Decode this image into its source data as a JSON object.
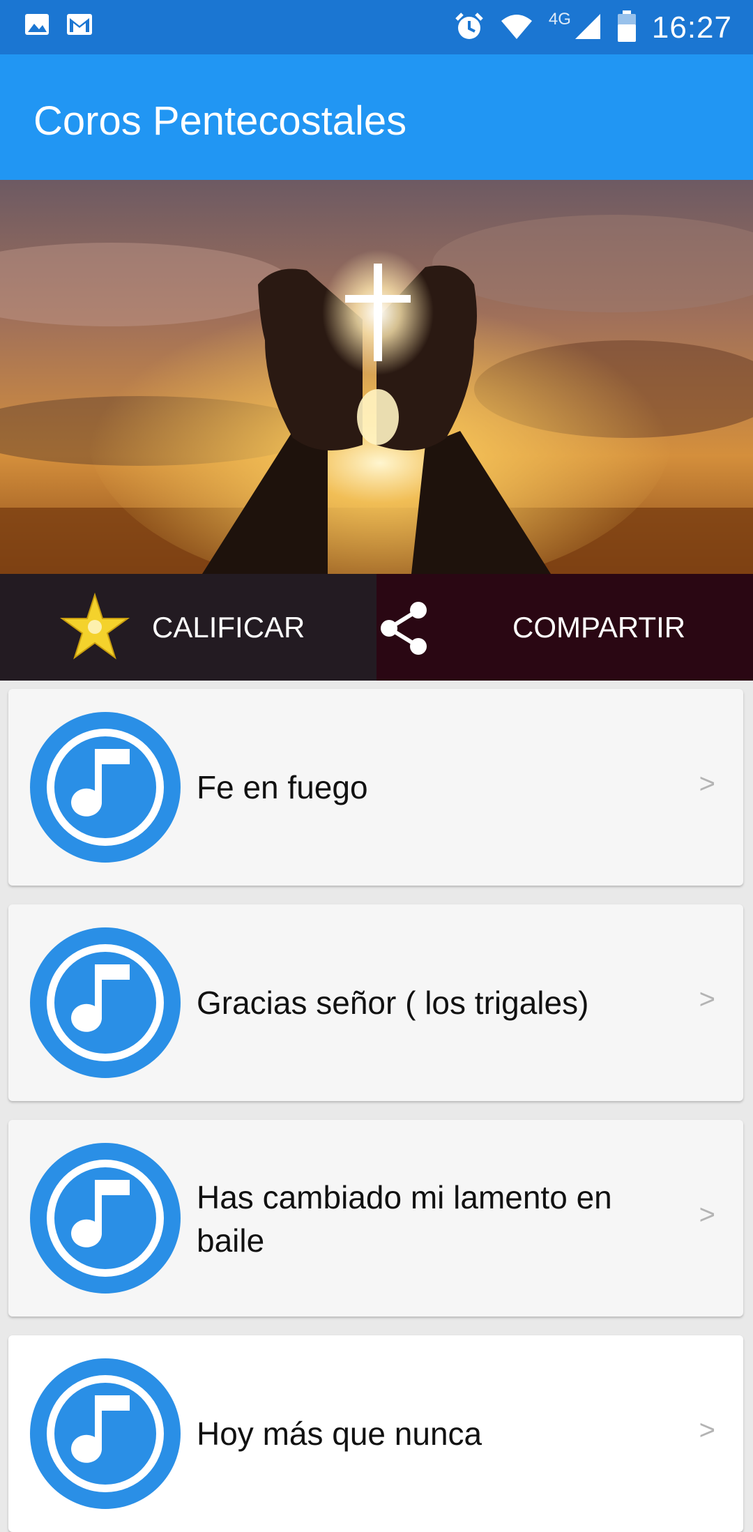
{
  "status_bar": {
    "time": "16:27",
    "network": "4G",
    "icons": [
      "image-icon",
      "gmail-icon",
      "alarm-icon",
      "wifi-icon",
      "signal-icon",
      "battery-icon"
    ]
  },
  "app_bar": {
    "title": "Coros Pentecostales",
    "color": "#2196f3"
  },
  "hero": {
    "image_description_icon": "praying-hands-cross-image"
  },
  "actions": {
    "rate": {
      "label": "CALIFICAR",
      "icon": "star-icon"
    },
    "share": {
      "label": "COMPARTIR",
      "icon": "share-icon"
    }
  },
  "songs": [
    {
      "title": "Fe en fuego",
      "chevron": ">",
      "icon": "music-note-icon"
    },
    {
      "title": "Gracias señor ( los trigales)",
      "chevron": ">",
      "icon": "music-note-icon"
    },
    {
      "title": "Has cambiado mi lamento en baile",
      "chevron": ">",
      "icon": "music-note-icon"
    },
    {
      "title": "Hoy más que nunca",
      "chevron": ">",
      "icon": "music-note-icon"
    }
  ],
  "colors": {
    "accent": "#2196f3",
    "status": "#1b76d2",
    "icon_blue": "#2a8fe6"
  }
}
